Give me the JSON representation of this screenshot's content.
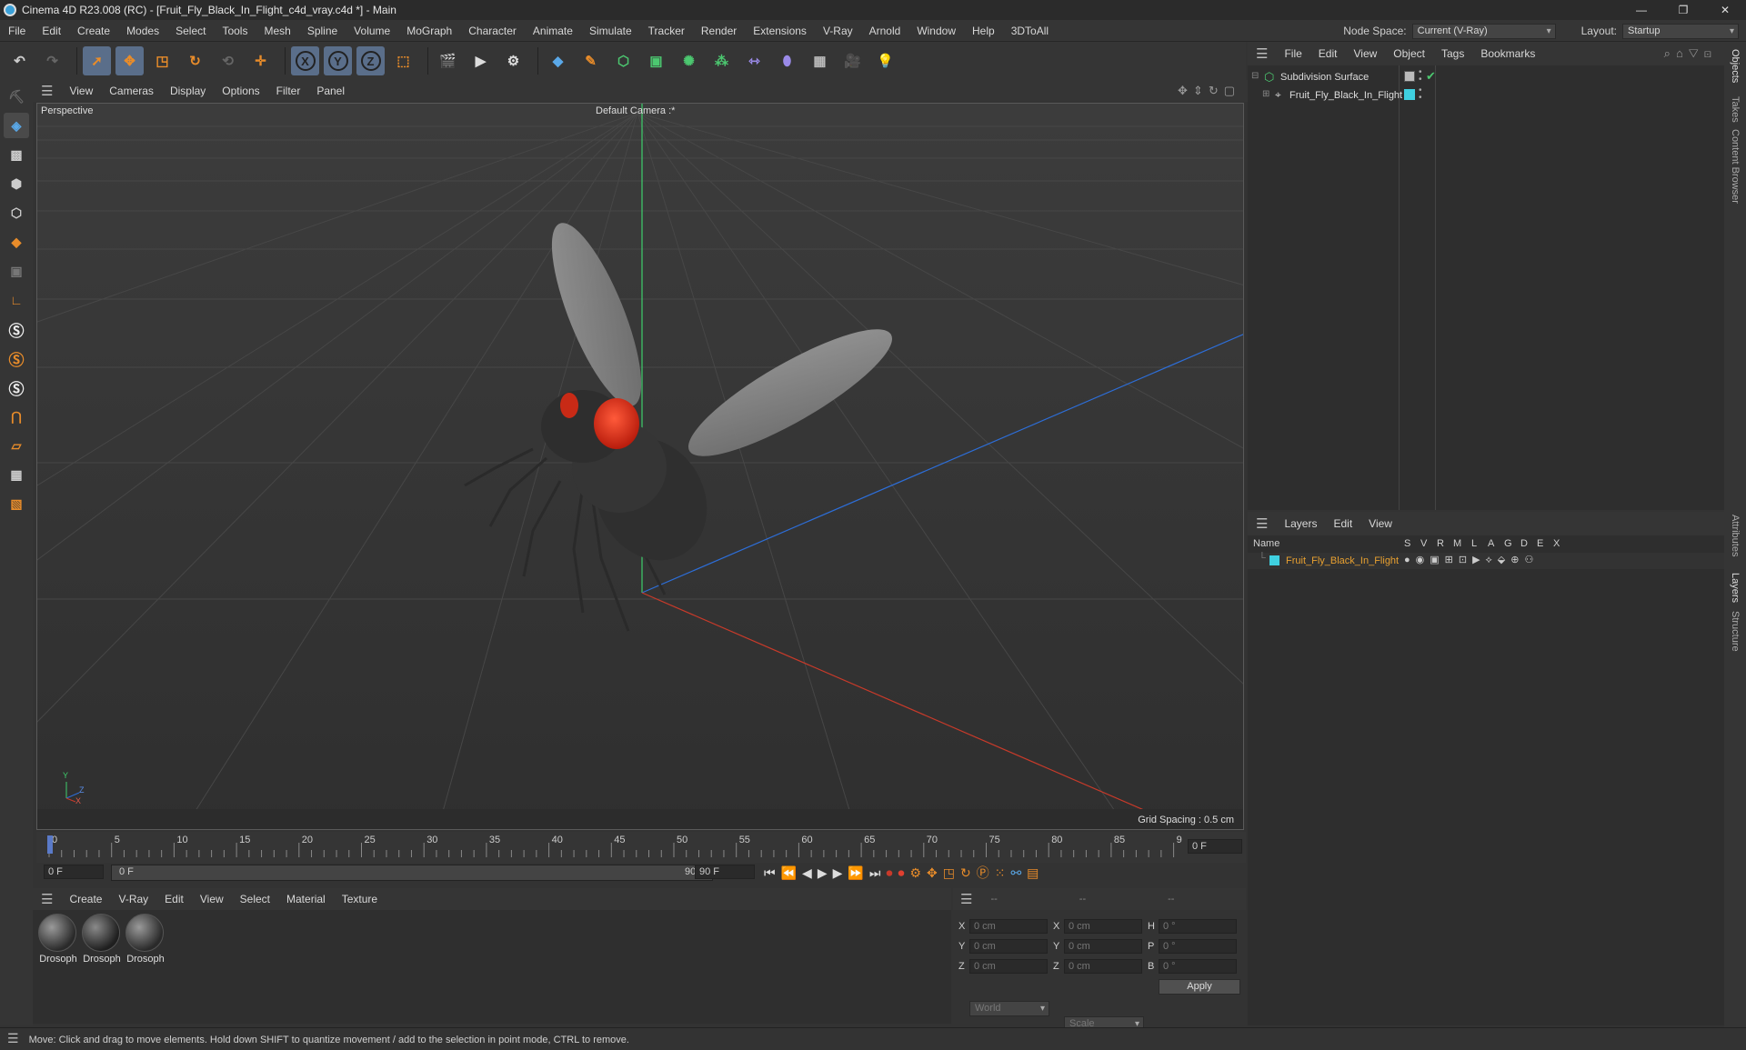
{
  "window": {
    "title": "Cinema 4D R23.008 (RC) - [Fruit_Fly_Black_In_Flight_c4d_vray.c4d *] - Main",
    "buttons": [
      "—",
      "❐",
      "✕"
    ]
  },
  "menubar": {
    "items": [
      "File",
      "Edit",
      "Create",
      "Modes",
      "Select",
      "Tools",
      "Mesh",
      "Spline",
      "Volume",
      "MoGraph",
      "Character",
      "Animate",
      "Simulate",
      "Tracker",
      "Render",
      "Extensions",
      "V-Ray",
      "Arnold",
      "Window",
      "Help",
      "3DToAll"
    ],
    "node_space_label": "Node Space:",
    "node_space_value": "Current (V-Ray)",
    "layout_label": "Layout:",
    "layout_value": "Startup"
  },
  "viewport": {
    "menu": [
      "View",
      "Cameras",
      "Display",
      "Options",
      "Filter",
      "Panel"
    ],
    "view_label": "Perspective",
    "camera_label": "Default Camera :*",
    "grid_spacing": "Grid Spacing : 0.5 cm",
    "axis": {
      "y": "Y",
      "z": "Z",
      "x": "X"
    }
  },
  "timeline": {
    "ticks": [
      "0",
      "5",
      "10",
      "15",
      "20",
      "25",
      "30",
      "35",
      "40",
      "45",
      "50",
      "55",
      "60",
      "65",
      "70",
      "75",
      "80",
      "85",
      "90"
    ],
    "current_frame": "0 F"
  },
  "playbar": {
    "start": "0 F",
    "range_start": "0 F",
    "range_end": "90 F",
    "end": "90 F"
  },
  "materials": {
    "menu": [
      "Create",
      "V-Ray",
      "Edit",
      "View",
      "Select",
      "Material",
      "Texture"
    ],
    "items": [
      {
        "label": "Drosoph"
      },
      {
        "label": "Drosoph"
      },
      {
        "label": "Drosoph"
      }
    ]
  },
  "coords": {
    "headers": [
      "--",
      "--",
      "--"
    ],
    "rows": [
      {
        "a": "X",
        "v1": "0 cm",
        "b": "X",
        "v2": "0 cm",
        "c": "H",
        "v3": "0 °"
      },
      {
        "a": "Y",
        "v1": "0 cm",
        "b": "Y",
        "v2": "0 cm",
        "c": "P",
        "v3": "0 °"
      },
      {
        "a": "Z",
        "v1": "0 cm",
        "b": "Z",
        "v2": "0 cm",
        "c": "B",
        "v3": "0 °"
      }
    ],
    "world": "World",
    "scale": "Scale",
    "apply": "Apply"
  },
  "objects": {
    "menu": [
      "File",
      "Edit",
      "View",
      "Object",
      "Tags",
      "Bookmarks"
    ],
    "items": [
      {
        "name": "Subdivision Surface"
      },
      {
        "name": "Fruit_Fly_Black_In_Flight"
      }
    ]
  },
  "layers": {
    "menu": [
      "Layers",
      "Edit",
      "View"
    ],
    "col_name": "Name",
    "cols": [
      "S",
      "V",
      "R",
      "M",
      "L",
      "A",
      "G",
      "D",
      "E",
      "X"
    ],
    "items": [
      {
        "name": "Fruit_Fly_Black_In_Flight"
      }
    ]
  },
  "right_tabs": [
    "Objects",
    "Takes",
    "Content Browser",
    "Attributes",
    "Layers",
    "Structure"
  ],
  "status": "Move: Click and drag to move elements. Hold down SHIFT to quantize movement / add to the selection in point mode, CTRL to remove.",
  "colors": {
    "accent": "#e88c2a",
    "layer_cyan": "#3fd0e0",
    "layer_name": "#e8a030"
  }
}
